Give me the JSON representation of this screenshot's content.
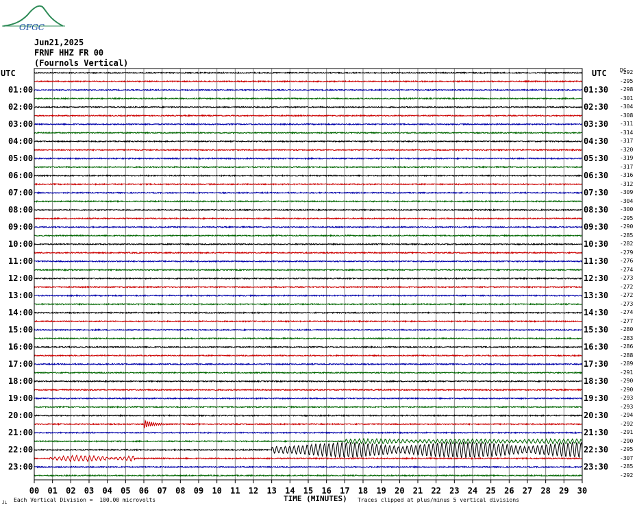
{
  "logo_text": "OFGC",
  "header": {
    "date": "Jun21,2025",
    "station": "FRNF HHZ FR 00",
    "location": "(Fournols Vertical)"
  },
  "axis": {
    "left_label": "UTC",
    "right_label": "UTC",
    "dc_label": "DC",
    "time_title": "TIME (MINUTES)"
  },
  "footer": {
    "scale_note": "Each Vertical Division =  100.00 microvolts",
    "clip_note": "Traces clipped at plus/minus 5 vertical divisions",
    "corner_mark": "JL"
  },
  "colors": {
    "trace_cycle": [
      "#000000",
      "#cc0000",
      "#0000aa",
      "#006600"
    ],
    "grid_line": "#808080",
    "frame": "#000000"
  },
  "chart_data": {
    "type": "helicorder",
    "x_minutes": [
      0,
      30
    ],
    "x_ticks": [
      "00",
      "01",
      "02",
      "03",
      "04",
      "05",
      "06",
      "07",
      "08",
      "09",
      "10",
      "11",
      "12",
      "13",
      "14",
      "15",
      "16",
      "17",
      "18",
      "19",
      "20",
      "21",
      "22",
      "23",
      "24",
      "25",
      "26",
      "27",
      "28",
      "29",
      "30"
    ],
    "line_minutes": 30,
    "line_count": 48,
    "left_hour_labels": [
      "01:00",
      "02:00",
      "03:00",
      "04:00",
      "05:00",
      "06:00",
      "07:00",
      "08:00",
      "09:00",
      "10:00",
      "11:00",
      "12:00",
      "13:00",
      "14:00",
      "15:00",
      "16:00",
      "17:00",
      "18:00",
      "19:00",
      "20:00",
      "21:00",
      "22:00",
      "23:00"
    ],
    "right_half_labels": [
      "01:30",
      "02:30",
      "03:30",
      "04:30",
      "05:30",
      "06:30",
      "07:30",
      "08:30",
      "09:30",
      "10:30",
      "11:30",
      "12:30",
      "13:30",
      "14:30",
      "15:30",
      "16:30",
      "17:30",
      "18:30",
      "19:30",
      "20:30",
      "21:30",
      "22:30",
      "23:30"
    ],
    "dc_offsets": [
      "-292",
      "-295",
      "-298",
      "-301",
      "-304",
      "-308",
      "-311",
      "-314",
      "-317",
      "-320",
      "-319",
      "-317",
      "-316",
      "-312",
      "-309",
      "-304",
      "-300",
      "-295",
      "-290",
      "-285",
      "-282",
      "-279",
      "-276",
      "-274",
      "-273",
      "-272",
      "-272",
      "-273",
      "-274",
      "-277",
      "-280",
      "-283",
      "-286",
      "-288",
      "-289",
      "-291",
      "-290",
      "-290",
      "-293",
      "-293",
      "-294",
      "-292",
      "-291",
      "-290",
      "-295",
      "-307",
      "-285",
      "-292"
    ],
    "events": [
      {
        "line": 41,
        "start_min": 6.0,
        "end_min": 7.2,
        "amp_div": 2.0,
        "label_color": "green"
      },
      {
        "line": 43,
        "start_min": 17.0,
        "end_min": 30,
        "amp_div": 1.0
      },
      {
        "line": 44,
        "start_min": 13.0,
        "end_min": 30,
        "amp_div": 3.5
      },
      {
        "line": 45,
        "start_min": 0.8,
        "end_min": 5.5,
        "amp_div": 1.3
      }
    ]
  }
}
